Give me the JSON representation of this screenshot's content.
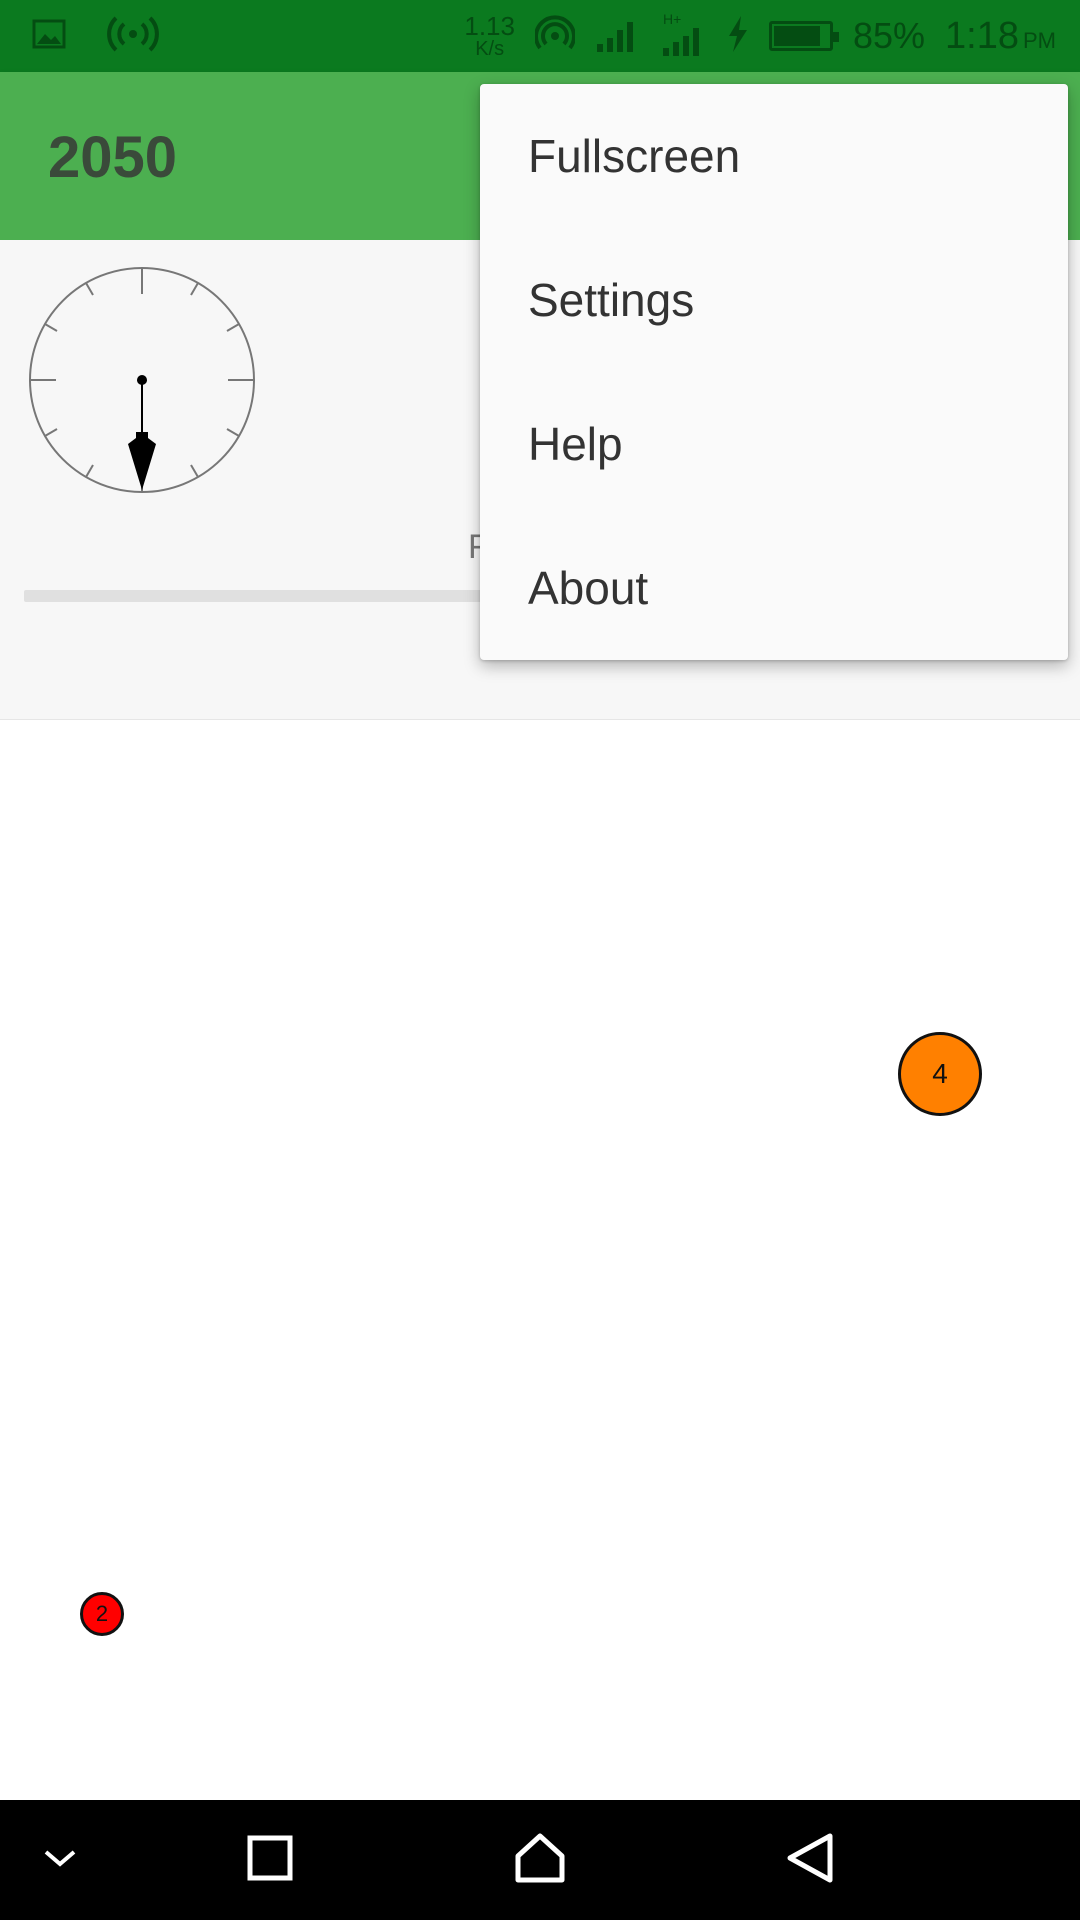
{
  "status_bar": {
    "icons_left": [
      "image-icon",
      "hotspot-icon"
    ],
    "net_speed": "1.13",
    "net_speed_unit": "K/s",
    "icons_right": [
      "wifi-icon",
      "signal-icon",
      "signal-h-plus-icon",
      "charging-icon",
      "battery-icon"
    ],
    "battery_level": 0.85,
    "battery_percent": "85%",
    "time": "1:18",
    "ampm": "PM",
    "color": "#0b7a1f"
  },
  "app_bar": {
    "title": "2050",
    "color": "#4caf50"
  },
  "panel": {
    "label_partial": "F",
    "progress": 0
  },
  "menu": {
    "items": [
      {
        "label": "Fullscreen"
      },
      {
        "label": "Settings"
      },
      {
        "label": "Help"
      },
      {
        "label": "About"
      }
    ]
  },
  "game": {
    "balls": [
      {
        "label": "4",
        "color": "#ff8000"
      },
      {
        "label": "2",
        "color": "#ff0000"
      }
    ]
  },
  "nav_bar": {
    "buttons": [
      "collapse-icon",
      "recents-icon",
      "home-icon",
      "back-icon"
    ]
  }
}
